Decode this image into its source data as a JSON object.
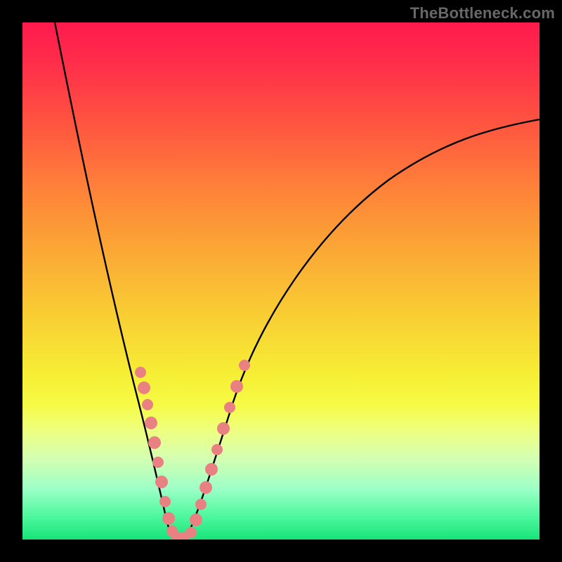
{
  "watermark": {
    "text": "TheBottleneck.com"
  },
  "chart_data": {
    "type": "line",
    "title": "",
    "xlabel": "",
    "ylabel": "",
    "xlim": [
      0,
      100
    ],
    "ylim": [
      0,
      100
    ],
    "grid": false,
    "legend": "none",
    "annotations": [
      "Background is a vertical color gradient: red at top through orange and yellow to green at bottom.",
      "A pink dotted overlay highlights the lower segments of both branches near the valley."
    ],
    "series": [
      {
        "name": "v-curve",
        "description": "Black V-shaped curve. Both branches descend to a common minimum near x≈29 at y≈0, then the right branch rises with diminishing slope.",
        "x": [
          5,
          10,
          15,
          20,
          23,
          25,
          27,
          28,
          29,
          30,
          31,
          33,
          36,
          40,
          50,
          60,
          70,
          80,
          90,
          100
        ],
        "y": [
          100,
          80,
          58,
          36,
          22,
          14,
          6,
          2,
          0,
          0,
          2,
          8,
          17,
          27,
          46,
          58,
          67,
          73,
          78,
          82
        ]
      },
      {
        "name": "dotted-highlight-left",
        "description": "Pink dots along the lower portion of the left branch.",
        "x": [
          21,
          22,
          23,
          24,
          25,
          26,
          27,
          28,
          29
        ],
        "y": [
          31,
          27,
          22,
          17,
          13,
          9,
          5,
          2,
          0
        ]
      },
      {
        "name": "dotted-highlight-right",
        "description": "Pink dots along the lower portion of the right branch.",
        "x": [
          30,
          31,
          32,
          33,
          34,
          35,
          36,
          37,
          38
        ],
        "y": [
          0,
          3,
          6,
          9,
          13,
          18,
          23,
          28,
          33
        ]
      }
    ],
    "colors": {
      "curve": "#000000",
      "dots": "#e98182",
      "gradient_top": "#ff1a4d",
      "gradient_mid": "#f6ee35",
      "gradient_bottom": "#18e47a"
    }
  }
}
